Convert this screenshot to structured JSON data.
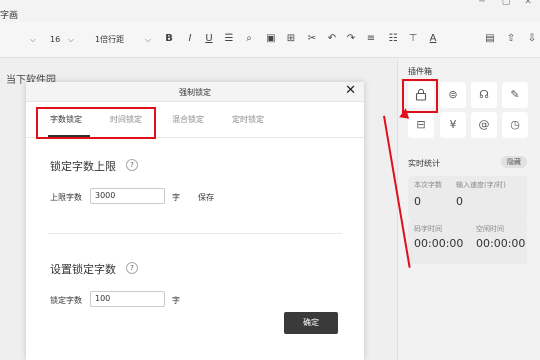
{
  "window": {
    "title": "字画",
    "controls": [
      "minimize-icon",
      "maximize-icon",
      "close-icon"
    ]
  },
  "toolbar": {
    "font_select": "",
    "size_select": "16",
    "line_select": "1倍行距",
    "icons": [
      "bold-icon",
      "italic-icon",
      "underline-icon",
      "strikethrough-icon",
      "search-icon",
      "image-icon",
      "table-icon",
      "cut-icon",
      "undo-icon",
      "redo-icon",
      "list-icon",
      "list-alt-icon",
      "shirt-icon",
      "font-color-icon",
      "save-icon",
      "export-icon",
      "download-icon"
    ]
  },
  "document": {
    "text": "当下软件园"
  },
  "dialog": {
    "title": "强制锁定",
    "tabs": [
      "字数锁定",
      "时间锁定",
      "混合锁定",
      "定时锁定"
    ],
    "active_tab": "字数锁定",
    "section1": {
      "title": "锁定字数上限",
      "help": "?",
      "label": "上限字数",
      "value": "3000",
      "unit": "字",
      "save": "保存"
    },
    "section2": {
      "title": "设置锁定字数",
      "help": "?",
      "label": "锁定字数",
      "value": "100",
      "unit": "字"
    },
    "ok_button": "确定"
  },
  "side_panel": {
    "plugins_title": "插件箱",
    "plugin_icons": [
      "lock-icon",
      "magnify-icon",
      "head-icon",
      "pen-icon",
      "table-icon",
      "yen-icon",
      "at-icon",
      "clock-icon"
    ],
    "stats_title": "实时统计",
    "hide_label": "隐藏",
    "stats": {
      "current_words_label": "本次字数",
      "current_words": "0",
      "speed_label": "输入速度(字/时)",
      "speed": "0",
      "typing_time_label": "码字时间",
      "typing_time": "00:00:00",
      "idle_time_label": "空闲时间",
      "idle_time": "00:00:00"
    }
  },
  "colors": {
    "highlight": "#e0101a",
    "button_dark": "#3a3a3a"
  }
}
